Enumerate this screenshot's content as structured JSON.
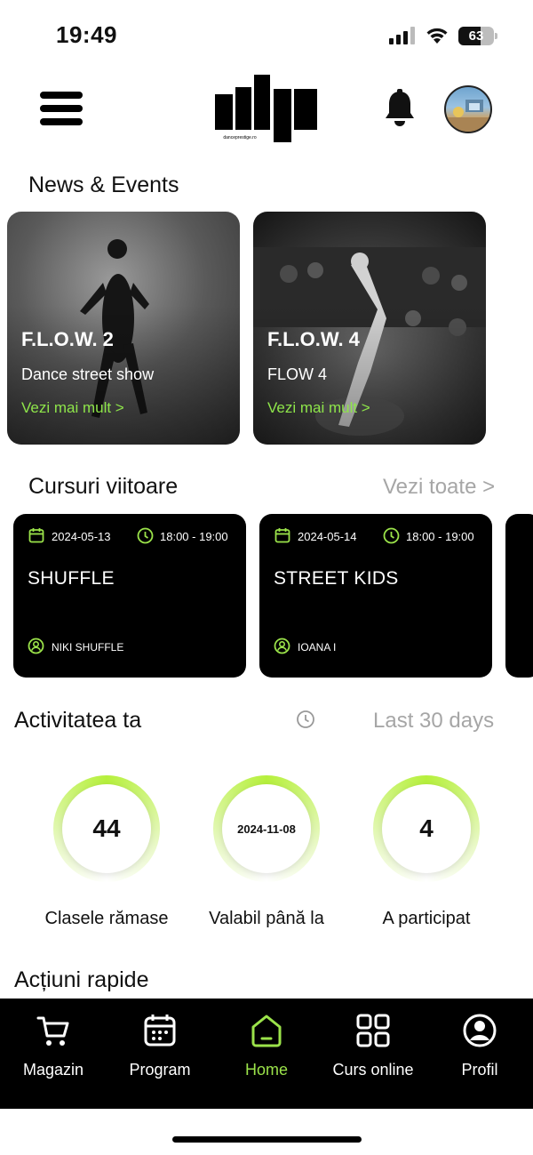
{
  "status_bar": {
    "time": "19:49",
    "battery": "63",
    "battery_level": 0.63
  },
  "header": {
    "logo_text": "danceprestige.ro"
  },
  "news": {
    "title": "News & Events",
    "items": [
      {
        "title": "F.L.O.W. 2",
        "subtitle": "Dance street show",
        "link": "Vezi mai mult >"
      },
      {
        "title": "F.L.O.W. 4",
        "subtitle": "FLOW 4",
        "link": "Vezi mai mult >"
      }
    ]
  },
  "courses": {
    "title": "Cursuri viitoare",
    "see_all": "Vezi toate >",
    "items": [
      {
        "date": "2024-05-13",
        "time": "18:00 - 19:00",
        "name": "SHUFFLE",
        "teacher": "NIKI SHUFFLE"
      },
      {
        "date": "2024-05-14",
        "time": "18:00 - 19:00",
        "name": "STREET KIDS",
        "teacher": "IOANA  I"
      }
    ]
  },
  "activity": {
    "title": "Activitatea ta",
    "period": "Last 30 days",
    "stats": [
      {
        "value": "44",
        "label": "Clasele rămase"
      },
      {
        "value": "2024-11-08",
        "label": "Valabil până la"
      },
      {
        "value": "4",
        "label": "A participat"
      }
    ]
  },
  "quick_actions": {
    "title": "Acțiuni rapide"
  },
  "nav": {
    "items": [
      {
        "label": "Magazin",
        "icon": "cart-icon"
      },
      {
        "label": "Program",
        "icon": "calendar-icon"
      },
      {
        "label": "Home",
        "icon": "home-icon"
      },
      {
        "label": "Curs online",
        "icon": "grid-icon"
      },
      {
        "label": "Profil",
        "icon": "profile-icon"
      }
    ],
    "active": "Home"
  },
  "colors": {
    "accent": "#9be34a",
    "ring": "#b6f03c",
    "card_bg": "#000000"
  }
}
